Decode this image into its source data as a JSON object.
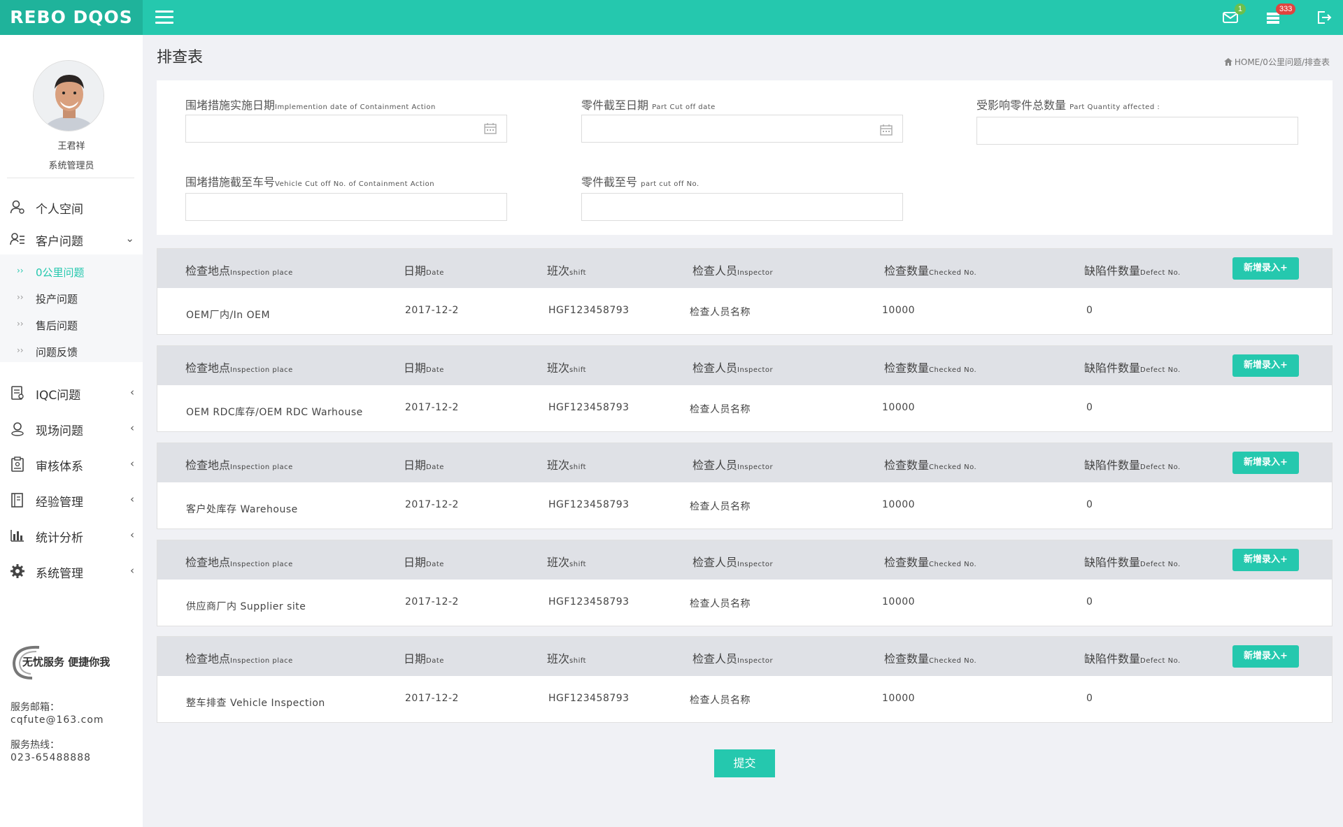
{
  "header": {
    "logo": "REBO DQOS",
    "mail_badge": "1",
    "tasks_badge": "333"
  },
  "user": {
    "name": "王君祥",
    "role": "系统管理员"
  },
  "sidebar": {
    "items": [
      {
        "label": "个人空间",
        "icon": "user-space-icon"
      },
      {
        "label": "客户问题",
        "icon": "customer-icon",
        "arrow": "⌄"
      },
      {
        "label": "IQC问题",
        "icon": "iqc-icon",
        "arrow": "‹"
      },
      {
        "label": "现场问题",
        "icon": "location-icon",
        "arrow": "‹"
      },
      {
        "label": "审核体系",
        "icon": "clipboard-icon",
        "arrow": "‹"
      },
      {
        "label": "经验管理",
        "icon": "book-icon",
        "arrow": "‹"
      },
      {
        "label": "统计分析",
        "icon": "bar-chart-icon",
        "arrow": "‹"
      },
      {
        "label": "系统管理",
        "icon": "gear-icon",
        "arrow": "‹"
      }
    ],
    "subitems": [
      {
        "label": "0公里问题",
        "bullet": "››",
        "active": true
      },
      {
        "label": "投产问题",
        "bullet": "››"
      },
      {
        "label": "售后问题",
        "bullet": "››"
      },
      {
        "label": "问题反馈",
        "bullet": "››"
      }
    ],
    "service_slogan": "无忧服务 便捷你我",
    "email_label": "服务邮箱：",
    "email": "cqfute@163.com",
    "phone_label": "服务热线：",
    "phone": "023-65488888"
  },
  "page": {
    "title": "排查表",
    "breadcrumb": "HOME/0公里问题/排查表"
  },
  "form": {
    "impl_date_cn": "围堵措施实施日期",
    "impl_date_en": "Implemention date of Containment Action",
    "part_cutoff_date_cn": "零件截至日期",
    "part_cutoff_date_en": "Part Cut off date",
    "qty_affected_cn": "受影响零件总数量",
    "qty_affected_en": "Part Quantity affected :",
    "vehicle_cutoff_cn": "围堵措施截至车号",
    "vehicle_cutoff_en": "Vehicle Cut off No. of Containment Action",
    "part_cutoff_no_cn": "零件截至号",
    "part_cutoff_no_en": "part cut off No."
  },
  "table_header": {
    "place_cn": "检查地点",
    "place_en": "Inspection place",
    "date_cn": "日期",
    "date_en": "Date",
    "shift_cn": "班次",
    "shift_en": "shift",
    "inspector_cn": "检查人员",
    "inspector_en": "Inspector",
    "checked_cn": "检查数量",
    "checked_en": "Checked No.",
    "defect_cn": "缺陷件数量",
    "defect_en": "Defect No.",
    "add_button": "新增录入+"
  },
  "rows": [
    {
      "place": "OEM厂内/In OEM",
      "date": "2017-12-2",
      "shift": "HGF123458793",
      "inspector": "检查人员名称",
      "checked": "10000",
      "defect": "0"
    },
    {
      "place": "OEM RDC库存/OEM RDC Warhouse",
      "date": "2017-12-2",
      "shift": "HGF123458793",
      "inspector": "检查人员名称",
      "checked": "10000",
      "defect": "0"
    },
    {
      "place": "客户处库存  Warehouse",
      "date": "2017-12-2",
      "shift": "HGF123458793",
      "inspector": "检查人员名称",
      "checked": "10000",
      "defect": "0"
    },
    {
      "place": "供应商厂内 Supplier site",
      "date": "2017-12-2",
      "shift": "HGF123458793",
      "inspector": "检查人员名称",
      "checked": "10000",
      "defect": "0"
    },
    {
      "place": "整车排查 Vehicle Inspection",
      "date": "2017-12-2",
      "shift": "HGF123458793",
      "inspector": "检查人员名称",
      "checked": "10000",
      "defect": "0"
    }
  ],
  "submit_label": "提交",
  "colors": {
    "accent": "#25c8ae",
    "accent_dark": "#1fb39b",
    "badge_red": "#e0443f",
    "badge_green": "#6cbf4d"
  }
}
